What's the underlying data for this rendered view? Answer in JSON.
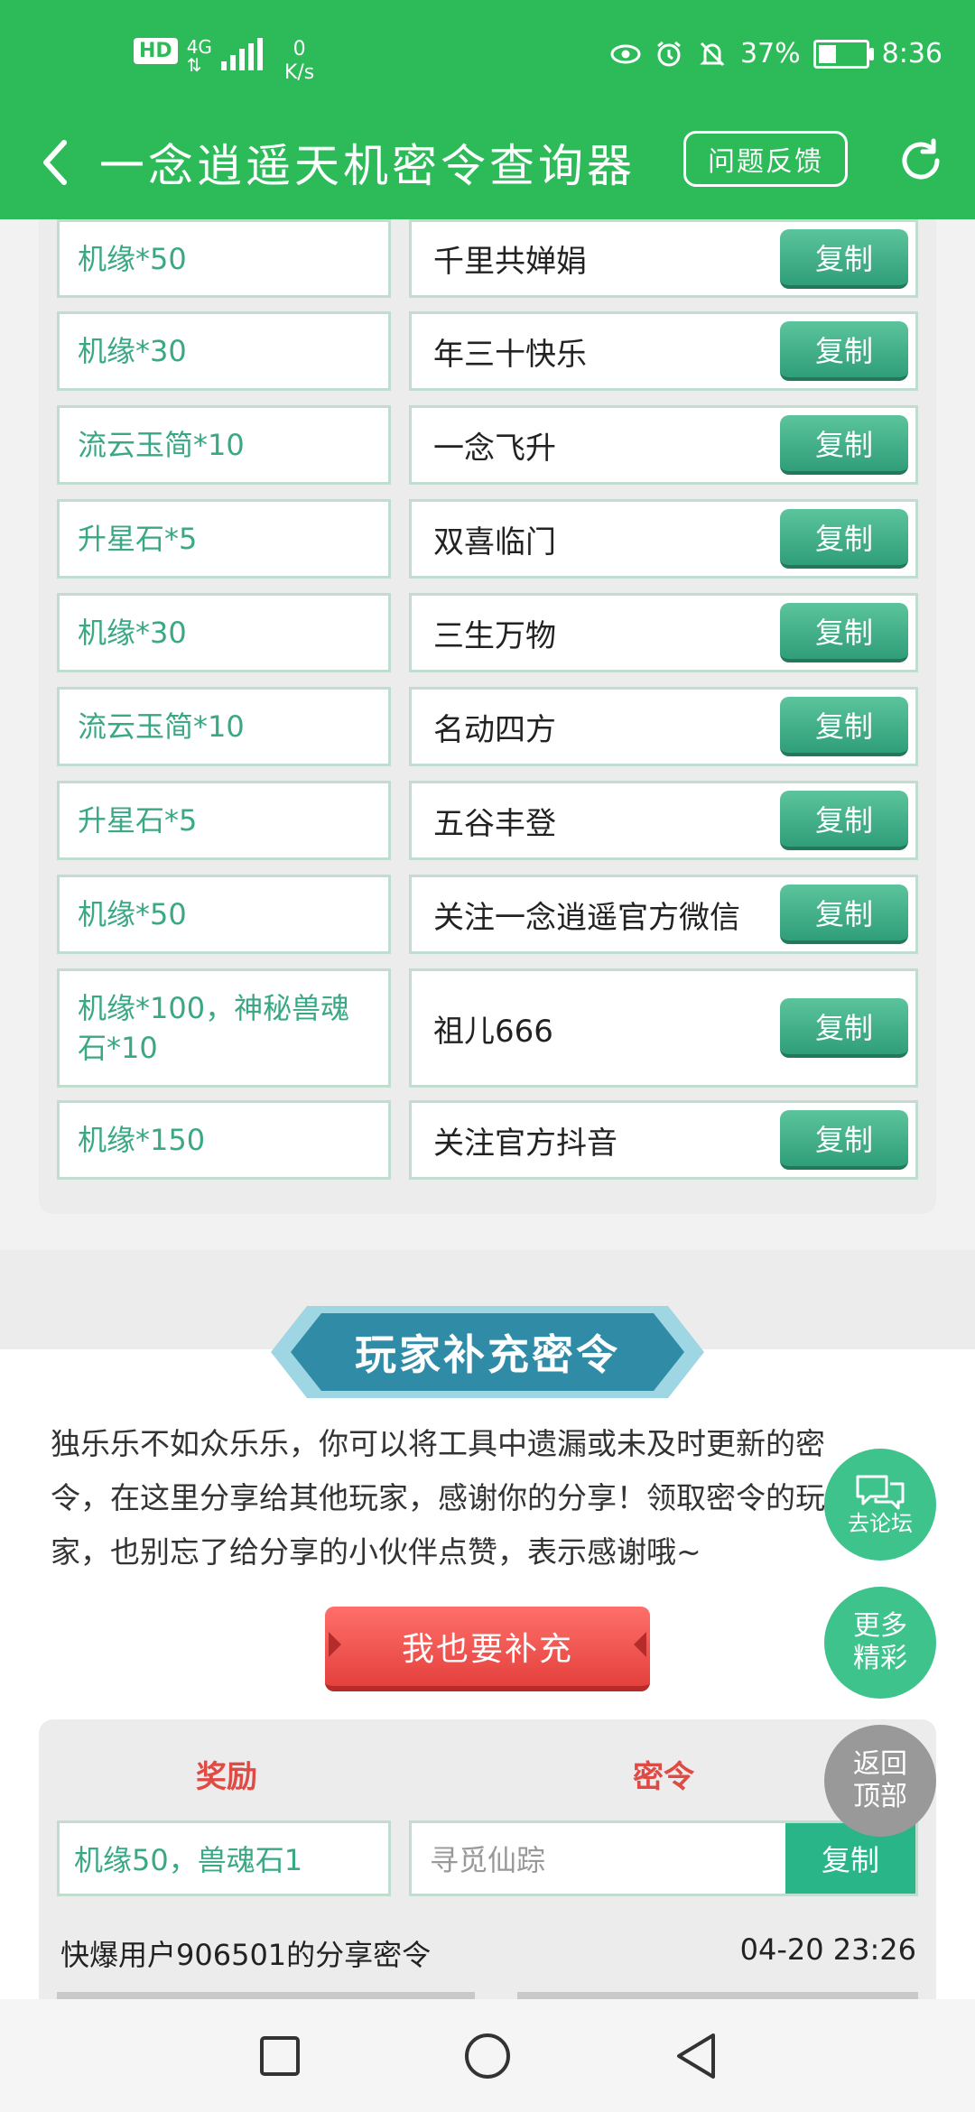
{
  "status_bar": {
    "hd": "HD",
    "network_top": "4G",
    "network_bottom": "⇅",
    "speed_value": "0",
    "speed_unit": "K/s",
    "battery": "37%",
    "battery_level": 0.37,
    "time": "8:36"
  },
  "header": {
    "title": "一念逍遥天机密令查询器",
    "feedback_label": "问题反馈"
  },
  "codes": [
    {
      "reward": "机缘*50",
      "code": "千里共婵娟",
      "copy": "复制"
    },
    {
      "reward": "机缘*30",
      "code": "年三十快乐",
      "copy": "复制"
    },
    {
      "reward": "流云玉简*10",
      "code": "一念飞升",
      "copy": "复制"
    },
    {
      "reward": "升星石*5",
      "code": "双喜临门",
      "copy": "复制"
    },
    {
      "reward": "机缘*30",
      "code": "三生万物",
      "copy": "复制"
    },
    {
      "reward": "流云玉简*10",
      "code": "名动四方",
      "copy": "复制"
    },
    {
      "reward": "升星石*5",
      "code": "五谷丰登",
      "copy": "复制"
    },
    {
      "reward": "机缘*50",
      "code": "关注一念逍遥官方微信",
      "copy": "复制"
    },
    {
      "reward": "机缘*100，神秘兽魂石*10",
      "code": "祖儿666",
      "copy": "复制"
    },
    {
      "reward": "机缘*150",
      "code": "关注官方抖音",
      "copy": "复制"
    }
  ],
  "player_section": {
    "title": "玩家补充密令",
    "intro": "独乐乐不如众乐乐，你可以将工具中遗漏或未及时更新的密令，在这里分享给其他玩家，感谢你的分享！领取密令的玩家，也别忘了给分享的小伙伴点赞，表示感谢哦~",
    "add_button": "我也要补充",
    "reward_header": "奖励",
    "code_header": "密令",
    "share": {
      "reward": "机缘50，兽魂石1",
      "code": "寻觅仙踪",
      "copy": "复制",
      "user": "快爆用户906501的分享密令",
      "time": "04-20 23:26"
    }
  },
  "floating": {
    "forum": "去论坛",
    "more_line1": "更多",
    "more_line2": "精彩",
    "top_line1": "返回",
    "top_line2": "顶部"
  }
}
